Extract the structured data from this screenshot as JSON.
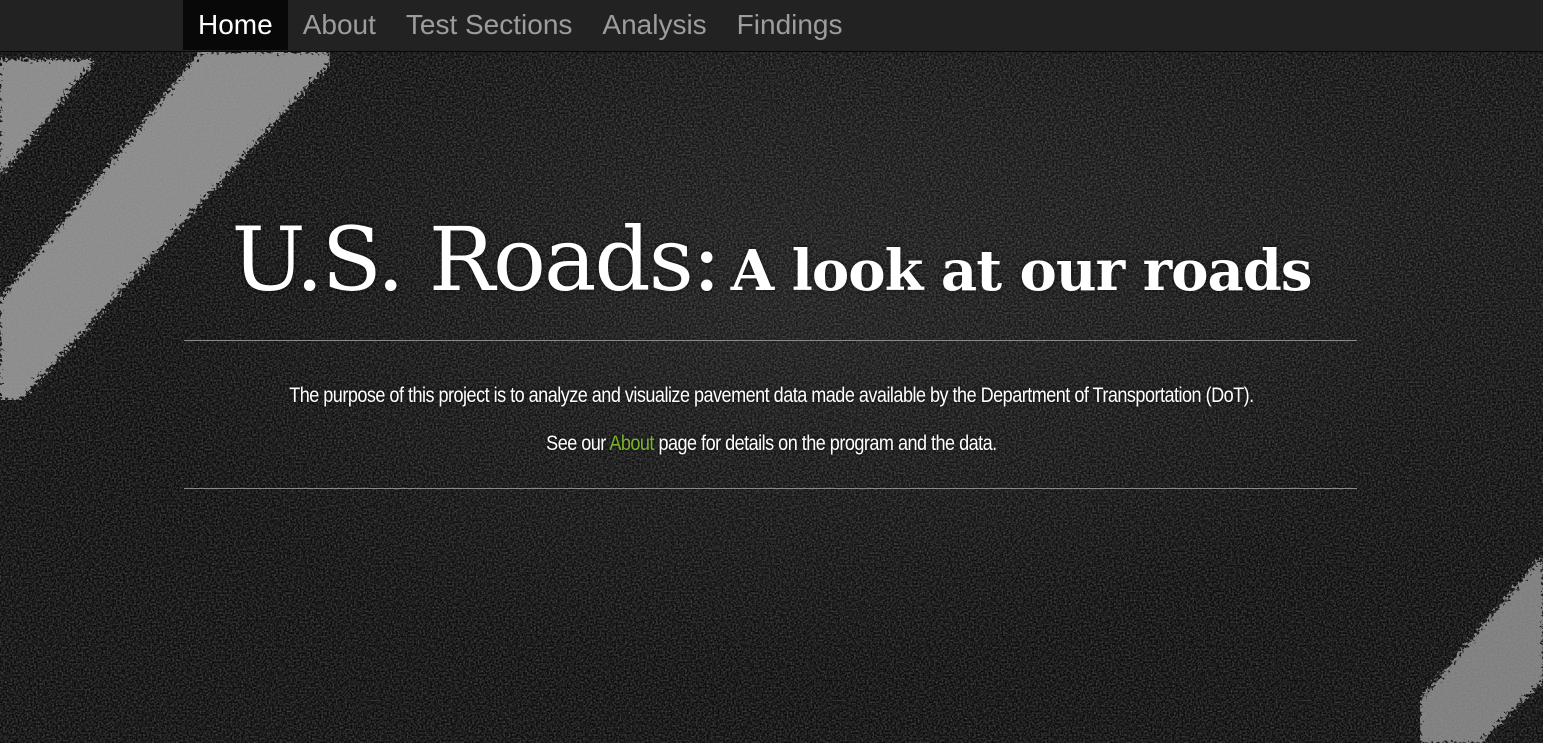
{
  "nav": {
    "items": [
      {
        "label": "Home",
        "active": true
      },
      {
        "label": "About",
        "active": false
      },
      {
        "label": "Test Sections",
        "active": false
      },
      {
        "label": "Analysis",
        "active": false
      },
      {
        "label": "Findings",
        "active": false
      }
    ]
  },
  "hero": {
    "title_main": "U.S. Roads:",
    "title_sub": "A look at our roads",
    "lead_line1": "The purpose of this project is to analyze and visualize pavement data made available by the Department of Transportation (DoT).",
    "lead_line2_prefix": "See our ",
    "lead_line2_link": "About",
    "lead_line2_suffix": " page for details on the program and the data."
  },
  "colors": {
    "navbar_bg": "#222222",
    "nav_active_bg": "#080808",
    "nav_text": "#9d9d9d",
    "link_accent": "#7ab32e",
    "text": "#ffffff"
  }
}
